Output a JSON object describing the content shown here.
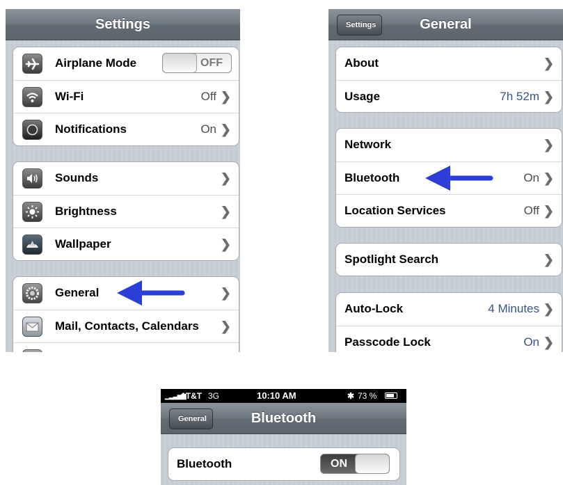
{
  "settings": {
    "title": "Settings",
    "airplane_mode": {
      "label": "Airplane Mode",
      "toggle": "OFF"
    },
    "group1": [
      {
        "label": "Wi-Fi",
        "value": "Off",
        "icon": "wifi-icon"
      },
      {
        "label": "Notifications",
        "value": "On",
        "icon": "notifications-icon"
      }
    ],
    "group2": [
      {
        "label": "Sounds",
        "icon": "sounds-icon"
      },
      {
        "label": "Brightness",
        "icon": "brightness-icon"
      },
      {
        "label": "Wallpaper",
        "icon": "wallpaper-icon"
      }
    ],
    "group3": [
      {
        "label": "General",
        "icon": "general-icon"
      },
      {
        "label": "Mail, Contacts, Calendars",
        "icon": "mail-icon"
      }
    ]
  },
  "general": {
    "back": "Settings",
    "title": "General",
    "group1": [
      {
        "label": "About",
        "value": ""
      },
      {
        "label": "Usage",
        "value": "7h 52m"
      }
    ],
    "group2": [
      {
        "label": "Network",
        "value": ""
      },
      {
        "label": "Bluetooth",
        "value": "On"
      },
      {
        "label": "Location Services",
        "value": "Off"
      }
    ],
    "group3": [
      {
        "label": "Spotlight Search",
        "value": ""
      }
    ],
    "group4": [
      {
        "label": "Auto-Lock",
        "value": "4 Minutes"
      },
      {
        "label": "Passcode Lock",
        "value": "On"
      }
    ]
  },
  "bluetooth": {
    "status_bar": {
      "carrier": "AT&T",
      "network": "3G",
      "time": "10:10 AM",
      "battery": "73 %"
    },
    "back": "General",
    "title": "Bluetooth",
    "row": {
      "label": "Bluetooth",
      "toggle": "ON"
    }
  },
  "colors": {
    "arrow": "#2b3fd6",
    "value_blue": "#385487"
  }
}
